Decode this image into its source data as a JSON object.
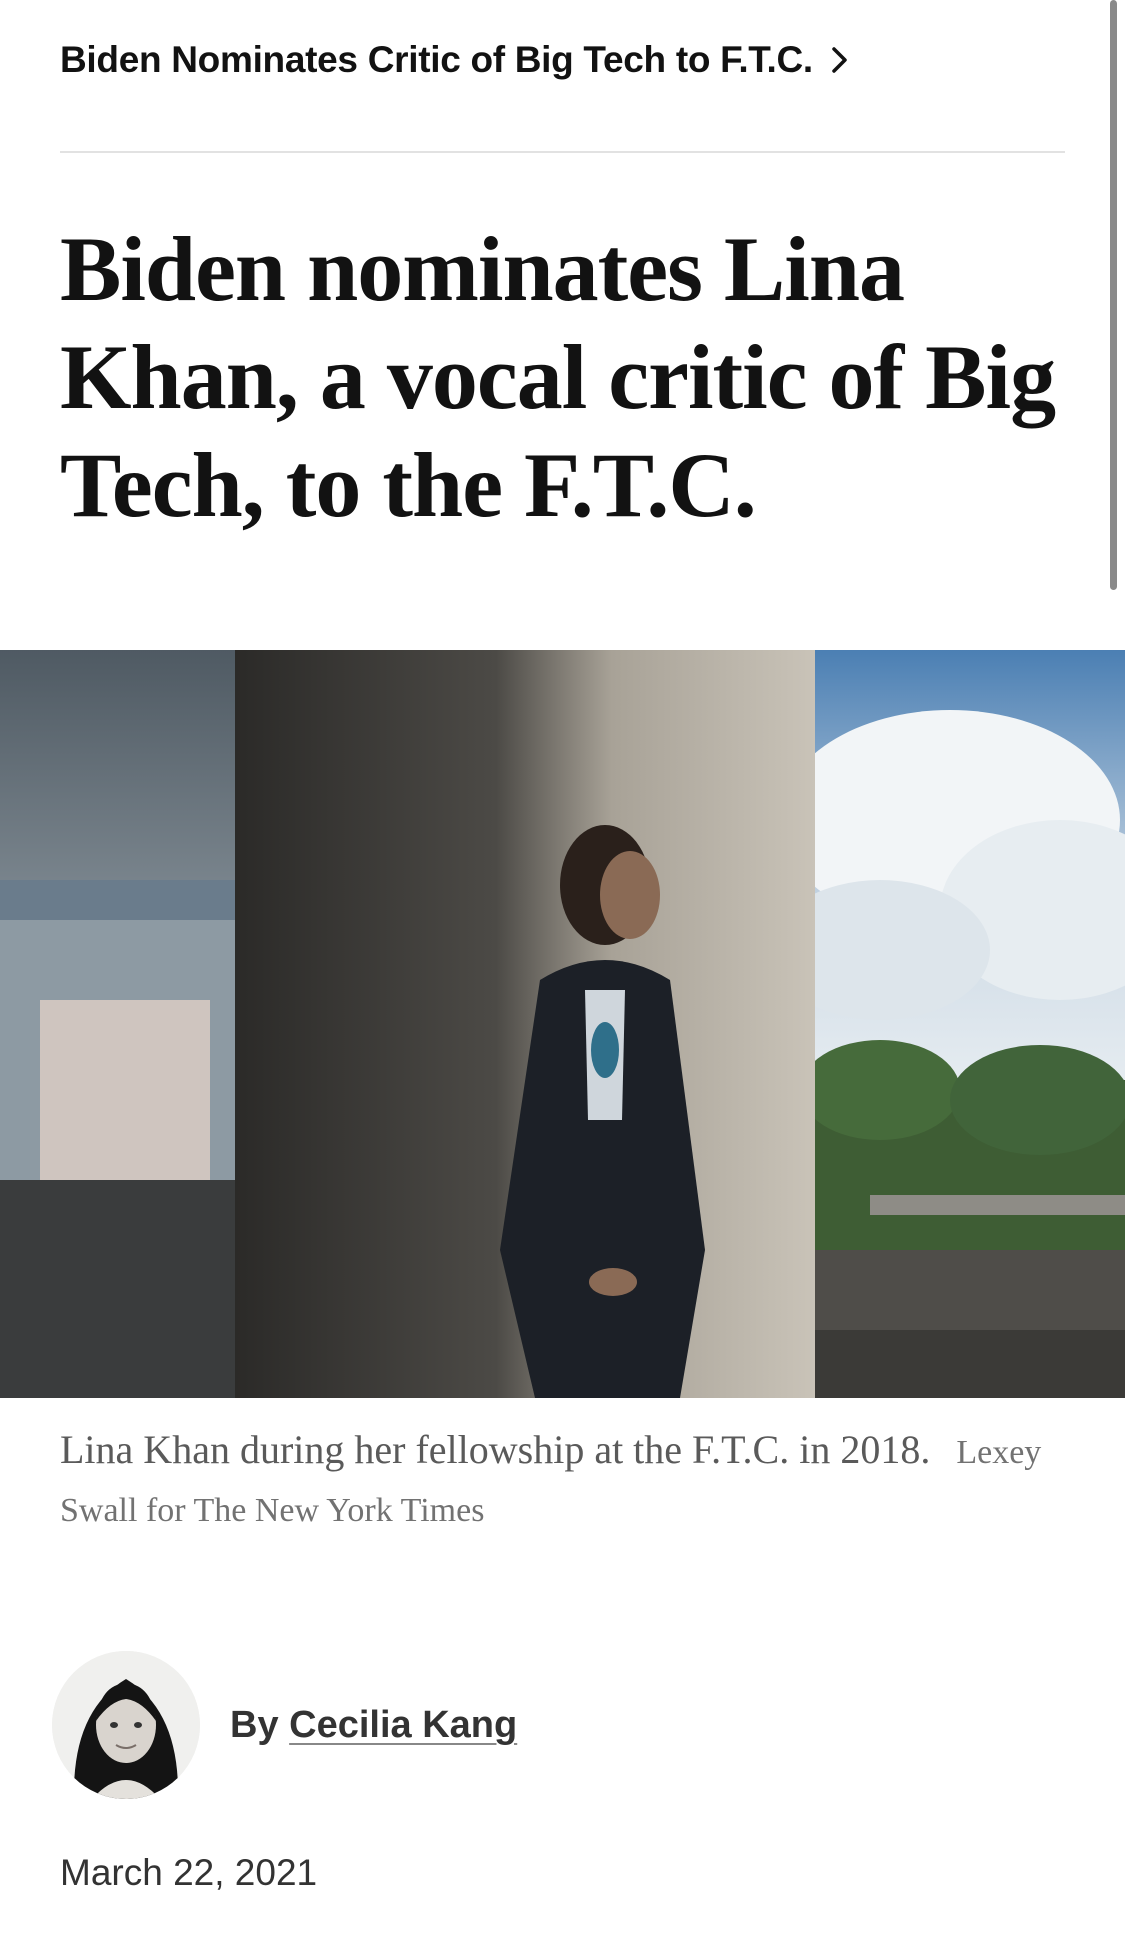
{
  "breadcrumb": {
    "label": "Biden Nominates Critic of Big Tech to F.T.C.",
    "icon": "chevron-right-icon"
  },
  "article": {
    "headline": "Biden nominates Lina Khan, a vocal critic of Big Tech, to the F.T.C.",
    "image": {
      "caption": "Lina Khan during her fellowship at the F.T.C. in 2018.",
      "credit": "Lexey Swall for The New York Times"
    },
    "byline": {
      "prefix": "By",
      "author": "Cecilia Kang"
    },
    "date": "March 22, 2021"
  }
}
